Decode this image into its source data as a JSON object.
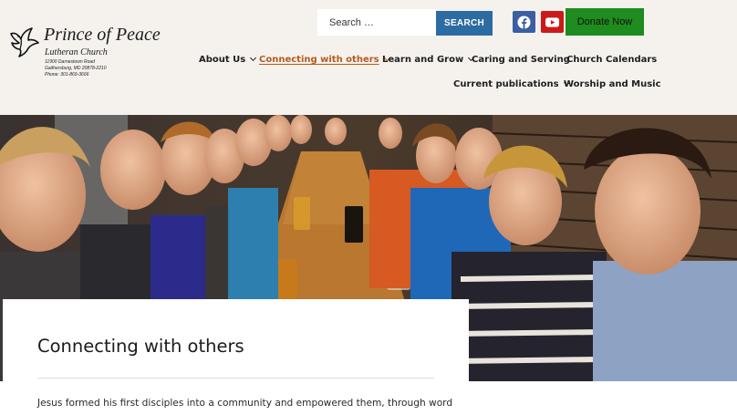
{
  "logo": {
    "name": "Prince of Peace",
    "subtitle": "Lutheran Church",
    "address_line1": "11900 Darnestown Road",
    "address_line2": "Gaithersburg, MD 20878-2210",
    "phone": "Phone: 301-869-3666"
  },
  "search": {
    "placeholder": "Search …",
    "button_label": "SEARCH"
  },
  "social": {
    "facebook_icon": "facebook-icon",
    "youtube_icon": "youtube-icon"
  },
  "donate_label": "Donate Now",
  "nav": {
    "items": [
      {
        "label": "About Us",
        "has_dropdown": true
      },
      {
        "label": "Connecting with others",
        "has_dropdown": true,
        "active": true
      },
      {
        "label": "Learn and Grow",
        "has_dropdown": true
      },
      {
        "label": "Caring and Serving",
        "has_dropdown": false
      },
      {
        "label": "Church Calendars",
        "has_dropdown": false
      },
      {
        "label": "Current publications",
        "has_dropdown": true
      },
      {
        "label": "Worship and Music",
        "has_dropdown": false
      }
    ]
  },
  "page": {
    "title": "Connecting with others",
    "body": "Jesus formed his first disciples into a community and empowered them, through word"
  },
  "colors": {
    "header_bg": "#f5f2ee",
    "accent_active": "#b65a1c",
    "search_button": "#2d6ca2",
    "donate": "#1e8c1e",
    "facebook": "#3b5fa0",
    "youtube": "#cc1a1a"
  }
}
